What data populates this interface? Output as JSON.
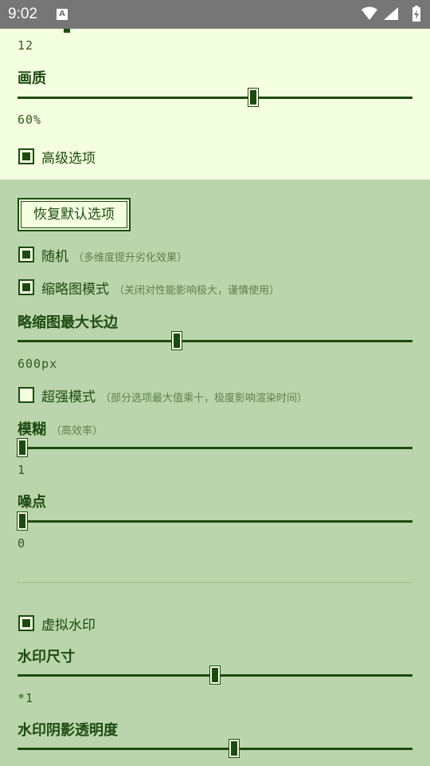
{
  "status_bar": {
    "time": "9:02",
    "notification_icon": "A",
    "icons": [
      "wifi-icon",
      "signal-icon",
      "battery-charging-icon"
    ]
  },
  "top_panel": {
    "prev_value": "12",
    "quality_label": "画质",
    "quality_value": "60%",
    "quality_percent": 60,
    "advanced_label": "高级选项",
    "advanced_checked": true
  },
  "reset_button": "恢复默认选项",
  "random": {
    "label": "随机",
    "hint": "（多维度提升劣化效果）",
    "checked": true
  },
  "thumbnail_mode": {
    "label": "缩略图模式",
    "hint": "（关闭对性能影响极大，谨慎使用）",
    "checked": true
  },
  "thumbnail_max_edge": {
    "label": "略缩图最大长边",
    "value": "600px",
    "fraction": 0.4
  },
  "super_mode": {
    "label": "超强模式",
    "hint": "（部分选项最大值乘十，极度影响渲染时间）",
    "checked": false
  },
  "blur": {
    "label": "模糊",
    "hint": "（高效率）",
    "value": "1",
    "fraction": 0.0
  },
  "noise": {
    "label": "噪点",
    "value": "0",
    "fraction": 0.0
  },
  "virtual_watermark": {
    "label": "虚拟水印",
    "checked": true
  },
  "watermark_size": {
    "label": "水印尺寸",
    "value": "*1",
    "fraction": 0.5
  },
  "watermark_shadow_opacity": {
    "label": "水印阴影透明度",
    "fraction": 0.55
  },
  "colors": {
    "primary": "#1e4a12",
    "top_bg": "#f4ffe0",
    "bg": "#bad5ab",
    "status_bar": "#767676"
  }
}
